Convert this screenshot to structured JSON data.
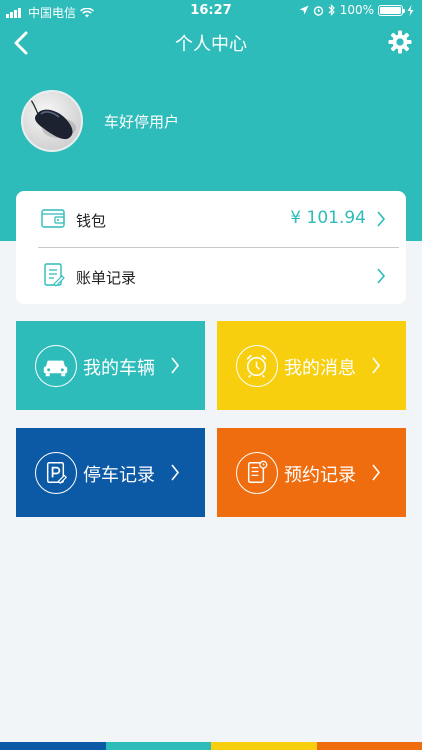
{
  "status_bar": {
    "carrier": "中国电信",
    "time": "16:27",
    "battery": "100%"
  },
  "nav": {
    "title": "个人中心"
  },
  "profile": {
    "username": "车好停用户"
  },
  "wallet_card": {
    "wallet_label": "钱包",
    "wallet_value": "¥ 101.94",
    "bills_label": "账单记录"
  },
  "tiles": [
    {
      "label": "我的车辆",
      "icon": "car-icon",
      "color": "#2ebcbb"
    },
    {
      "label": "我的消息",
      "icon": "alarm-clock-icon",
      "color": "#f7cf0f"
    },
    {
      "label": "停车记录",
      "icon": "parking-icon",
      "color": "#0c5aa6"
    },
    {
      "label": "预约记录",
      "icon": "notebook-icon",
      "color": "#ef6d0e"
    }
  ],
  "colors": {
    "primary": "#2ebcbb",
    "yellow": "#f7cf0f",
    "blue": "#0c5aa6",
    "orange": "#ef6d0e",
    "background": "#f1f5f8"
  },
  "bottom_strip_colors": [
    "#0c5aa6",
    "#2ebcbb",
    "#f7cf0f",
    "#ef6d0e"
  ]
}
